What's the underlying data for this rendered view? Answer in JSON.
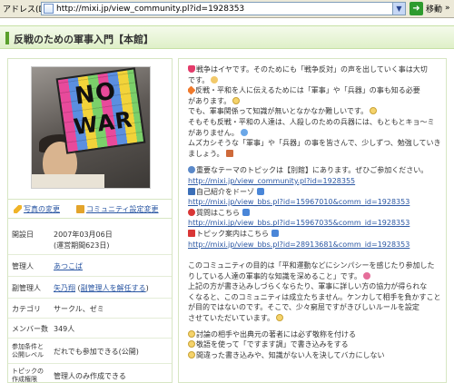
{
  "browser": {
    "address_label": "アドレス(D)",
    "url": "http://mixi.jp/view_community.pl?id=1928353",
    "go_label": "移動",
    "chevron": "»"
  },
  "page": {
    "title": "反戦のための軍事入門【本館】"
  },
  "photo": {
    "sign_top": "NO",
    "sign_bottom": "WAR"
  },
  "left_links": {
    "photo_change": "写真の変更",
    "settings_change": "コミュニティ設定変更"
  },
  "info": {
    "opened_key": "開設日",
    "opened_val": "2007年03月06日",
    "opened_sub": "(運営期間623日)",
    "admin_key": "管理人",
    "admin_name": "あつこば",
    "subadmin_key": "副管理人",
    "subadmin_name": "矢乃翔",
    "subadmin_paren_open": " (",
    "subadmin_action": "副管理人を解任する",
    "subadmin_paren_close": ")",
    "category_key": "カテゴリ",
    "category_val": "サークル、ゼミ",
    "members_key": "メンバー数",
    "members_val": "349人",
    "join_key_1": "参加条件と",
    "join_key_2": "公開レベル",
    "join_val": "だれでも参加できる(公開)",
    "topic_key_1": "トピックの",
    "topic_key_2": "作成権限",
    "topic_val": "管理人のみ作成できる"
  },
  "description": {
    "l01": "戦争はイヤです。そのためにも「戦争反対」の声を出していく事は大切",
    "l02": "です。",
    "l03": "反戦・平和を人に伝えるためには「軍事」や「兵器」の事も知る必要",
    "l04": "があります。",
    "l05": "でも、軍事関係って知識が無いとなかなか難しいです。",
    "l06": "そもそも反戦・平和の人達は、人殺しのための兵器には、もともとキョ～ミ",
    "l07": "がありません。",
    "l08": "ムズカシそうな「軍事」や「兵器」の事を皆さんで、少しずつ、勉強していき",
    "l09": "ましょう。",
    "l10": "重要なテーマのトピックは【別館】にあります。ぜひご参加ください。",
    "l11": "http://mixi.jp/view_community.pl?id=1928355",
    "l12": "自己紹介をドーゾ",
    "l13": "http://mixi.jp/view_bbs.pl?id=15967010&comm_id=1928353",
    "l14": "質問はこちら",
    "l15": "http://mixi.jp/view_bbs.pl?id=15967035&comm_id=1928353",
    "l16": "トピック案内はこちら",
    "l17": "http://mixi.jp/view_bbs.pl?id=28913681&comm_id=1928353",
    "l18": "このコミュニティの目的は「平和運動などにシンパシーを感じたり参加した",
    "l19": "りしている人達の軍事的な知識を深めること」です。",
    "l20": "上記の方が書き込みしづらくならたり、軍事に詳しい方の協力が得られな",
    "l21": "くなると、このコミュニティは成立たちません。ケンカして相手を負かすこと",
    "l22": "が目的ではないのです。そこで、少々窮屈ですがきびしいルールを設定",
    "l23": "させていただいています。",
    "l24": "討論の相手や出典元の著者には必ず敬称を付ける",
    "l25": "敬語を使って「ですます調」で書き込みをする",
    "l26": "間違った書き込みや、知識がない人を決してバカにしない"
  },
  "colors": {
    "accent_green": "#5aa02c",
    "link_blue": "#2b57a3",
    "border_green": "#d7e6c3"
  }
}
